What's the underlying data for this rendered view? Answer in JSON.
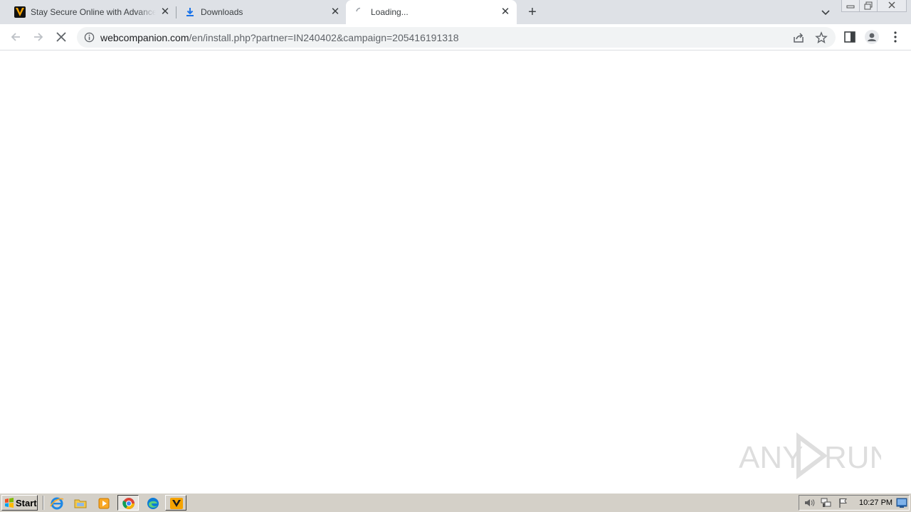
{
  "browser": {
    "tabs": [
      {
        "title": "Stay Secure Online with Advanced Antivirus",
        "favicon": "webcompanion-shield-icon",
        "active": false
      },
      {
        "title": "Downloads",
        "favicon": "download-icon",
        "active": false
      },
      {
        "title": "Loading...",
        "favicon": "loading-spinner-icon",
        "active": true
      }
    ],
    "new_tab_icon": "plus-icon",
    "address_bar": {
      "host": "webcompanion.com",
      "path": "/en/install.php?partner=IN240402&campaign=205416191318"
    },
    "nav_icons": [
      "back-arrow-icon",
      "forward-arrow-icon",
      "stop-icon"
    ]
  },
  "watermark": {
    "text": "ANY RUN"
  },
  "taskbar": {
    "start_label": "Start",
    "clock": "10:27 PM"
  },
  "colors": {
    "tabstrip": "#dee1e6",
    "omnibox": "#f1f3f4",
    "taskbar": "#d4d0c8",
    "download_blue": "#1a73e8"
  }
}
